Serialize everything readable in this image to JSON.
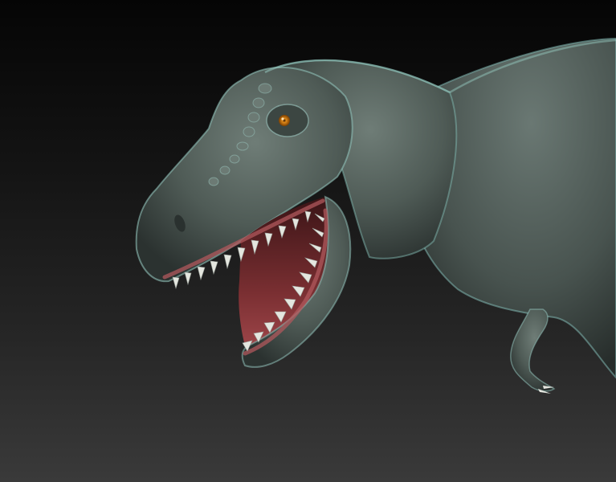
{
  "scene": {
    "subject": "dinosaur-sculpt-render",
    "colors": {
      "background_top": "#050505",
      "background_bottom": "#3a3a3a",
      "skin": "#5a6660",
      "skin_highlight": "#8fa8a0",
      "rim_light": "#7fb7b0",
      "mouth_interior": "#8a3a3c",
      "gum": "#b0585c",
      "teeth": "#e4e6df",
      "eye_iris": "#e08a1a"
    },
    "icons": []
  }
}
